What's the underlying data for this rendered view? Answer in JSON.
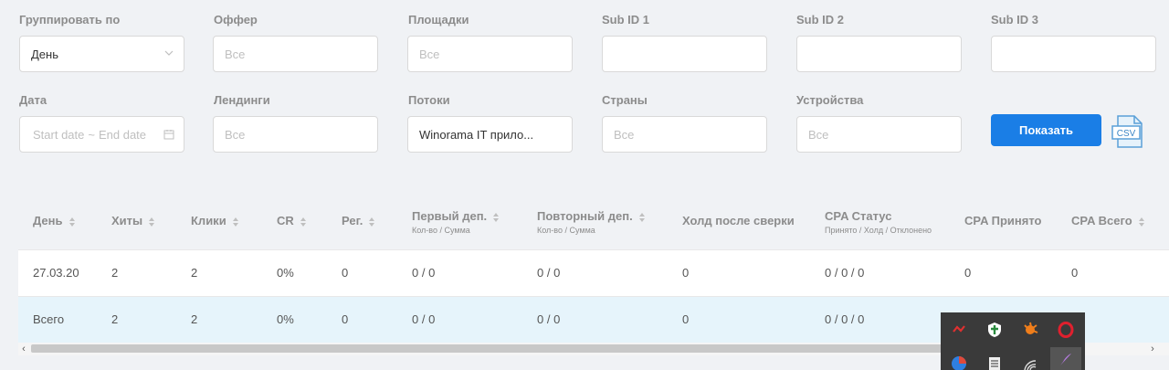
{
  "filters": {
    "group_by": {
      "label": "Группировать по",
      "value": "День"
    },
    "offer": {
      "label": "Оффер",
      "placeholder": "Все"
    },
    "platforms": {
      "label": "Площадки",
      "placeholder": "Все"
    },
    "sub1": {
      "label": "Sub ID 1"
    },
    "sub2": {
      "label": "Sub ID 2"
    },
    "sub3": {
      "label": "Sub ID 3"
    },
    "date": {
      "label": "Дата",
      "start": "Start date",
      "sep": "~",
      "end": "End date"
    },
    "landings": {
      "label": "Лендинги",
      "placeholder": "Все"
    },
    "streams": {
      "label": "Потоки",
      "value": "Winorama IT прило..."
    },
    "countries": {
      "label": "Страны",
      "placeholder": "Все"
    },
    "devices": {
      "label": "Устройства",
      "placeholder": "Все"
    }
  },
  "actions": {
    "show_label": "Показать",
    "csv_label": "CSV"
  },
  "table": {
    "columns": [
      {
        "label": "День"
      },
      {
        "label": "Хиты"
      },
      {
        "label": "Клики"
      },
      {
        "label": "CR"
      },
      {
        "label": "Рег."
      },
      {
        "label": "Первый деп.",
        "sub": "Кол-во / Сумма"
      },
      {
        "label": "Повторный деп.",
        "sub": "Кол-во / Сумма"
      },
      {
        "label": "Холд после сверки"
      },
      {
        "label": "CPA Статус",
        "sub": "Принято / Холд / Отклонено"
      },
      {
        "label": "CPA Принято"
      },
      {
        "label": "CPA Всего"
      }
    ],
    "rows": [
      [
        "27.03.20",
        "2",
        "2",
        "0%",
        "0",
        "0 / 0",
        "0 / 0",
        "0",
        "0 / 0 / 0",
        "0",
        "0"
      ],
      [
        "Всего",
        "2",
        "2",
        "0%",
        "0",
        "0 / 0",
        "0 / 0",
        "0",
        "0 / 0 / 0",
        "",
        ""
      ]
    ]
  },
  "scroll": {
    "left": "‹",
    "right": "›"
  },
  "tray_icons": [
    "network-icon",
    "shield-icon",
    "avast-icon",
    "opera-icon",
    "browser-icon",
    "keyboard-icon",
    "wifi-icon",
    "feather-icon"
  ]
}
